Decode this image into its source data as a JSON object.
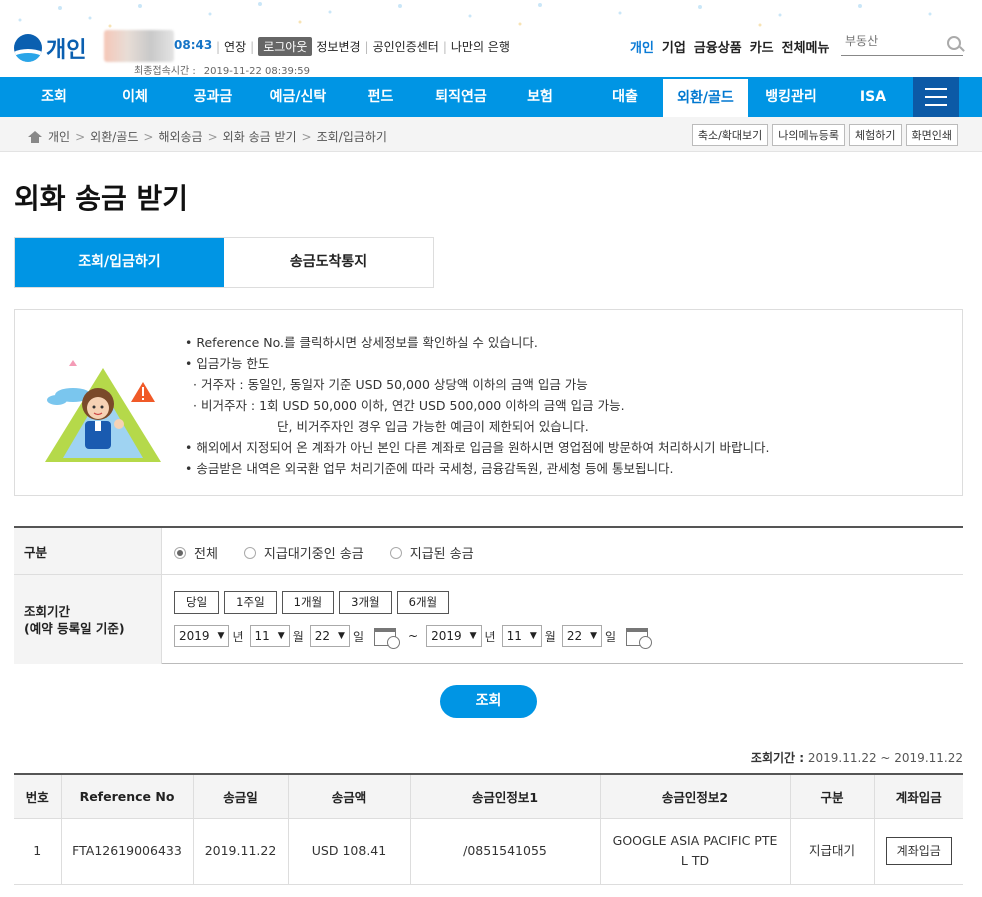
{
  "header": {
    "brand": "개인",
    "session_timer": "08:43",
    "extend_label": "연장",
    "logout_label": "로그아웃",
    "info_change_label": "정보변경",
    "cert_center_label": "공인인증센터",
    "my_bank_label": "나만의 은행",
    "last_login_label": "최종접속시간 :",
    "last_login_value": "2019-11-22 08:39:59",
    "top_links": [
      "개인",
      "기업",
      "금융상품",
      "카드",
      "전체메뉴"
    ],
    "search_placeholder": "부동산"
  },
  "gnb": {
    "items": [
      "조회",
      "이체",
      "공과금",
      "예금/신탁",
      "펀드",
      "퇴직연금",
      "보험",
      "대출",
      "외환/골드",
      "뱅킹관리",
      "ISA"
    ],
    "active": "외환/골드"
  },
  "breadcrumb": {
    "items": [
      "개인",
      "외환/골드",
      "해외송금",
      "외화 송금 받기",
      "조회/입금하기"
    ]
  },
  "util_buttons": [
    "축소/확대보기",
    "나의메뉴등록",
    "체험하기",
    "화면인쇄"
  ],
  "page_title": "외화 송금 받기",
  "tabs": [
    "조회/입금하기",
    "송금도착통지"
  ],
  "notice": {
    "lines": [
      "• Reference No.를 클릭하시면 상세정보를 확인하실 수 있습니다.",
      "• 입금가능 한도",
      "· 거주자 : 동일인, 동일자 기준 USD 50,000 상당액 이하의 금액 입금 가능",
      "· 비거주자 : 1회 USD 50,000 이하, 연간 USD 500,000 이하의 금액 입금 가능.",
      "단, 비거주자인 경우 입금 가능한 예금이 제한되어 있습니다.",
      "• 해외에서 지정되어 온 계좌가 아닌 본인 다른 계좌로 입금을 원하시면 영업점에 방문하여 처리하시기 바랍니다.",
      "• 송금받은 내역은 외국환 업무 처리기준에 따라 국세청, 금융감독원, 관세청 등에 통보됩니다."
    ]
  },
  "form": {
    "type_label": "구분",
    "type_options": [
      "전체",
      "지급대기중인 송금",
      "지급된 송금"
    ],
    "type_selected": "전체",
    "period_label_1": "조회기간",
    "period_label_2": "(예약 등록일 기준)",
    "period_buttons": [
      "당일",
      "1주일",
      "1개월",
      "3개월",
      "6개월"
    ],
    "from": {
      "year": "2019",
      "month": "11",
      "day": "22"
    },
    "to": {
      "year": "2019",
      "month": "11",
      "day": "22"
    },
    "unit_year": "년",
    "unit_month": "월",
    "unit_day": "일",
    "tilde": "~"
  },
  "query_button": "조회",
  "result": {
    "period_label": "조회기간 :",
    "period_value": "2019.11.22 ~ 2019.11.22",
    "columns": [
      "번호",
      "Reference No",
      "송금일",
      "송금액",
      "송금인정보1",
      "송금인정보2",
      "구분",
      "계좌입금"
    ],
    "rows": [
      {
        "no": "1",
        "ref": "FTA12619006433",
        "date": "2019.11.22",
        "amount": "USD 108.41",
        "info1": "/0851541055",
        "info2": "GOOGLE ASIA PACIFIC PTE L TD",
        "status": "지급대기",
        "action": "계좌입금"
      }
    ]
  }
}
